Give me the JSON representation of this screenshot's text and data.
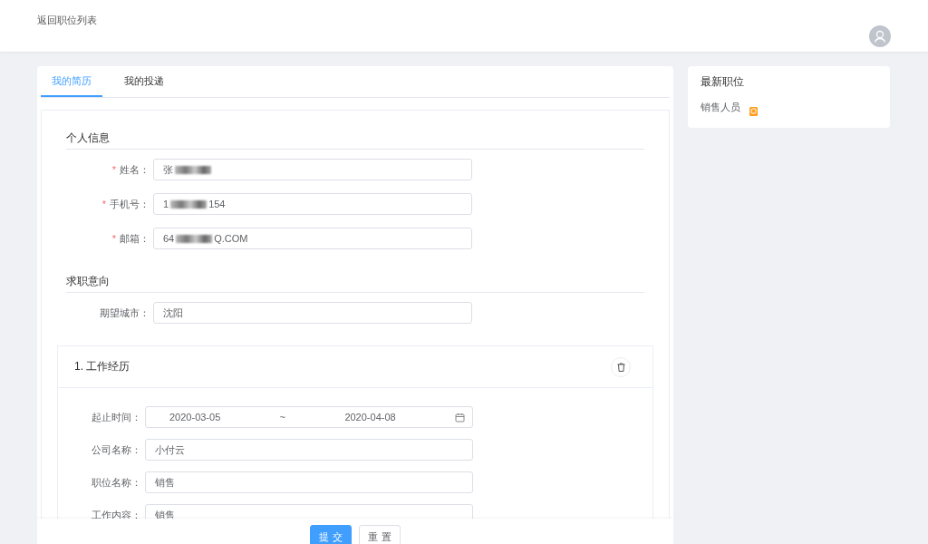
{
  "header": {
    "back_link": "返回职位列表"
  },
  "tabs": [
    {
      "label": "我的简历",
      "selected": true
    },
    {
      "label": "我的投递",
      "selected": false
    }
  ],
  "sections": [
    {
      "title": "个人信息",
      "fields": [
        {
          "required_mark": "*",
          "label": "姓名：",
          "value_start": "张",
          "redacted": true
        },
        {
          "required_mark": "*",
          "label": "手机号：",
          "value_start": "1",
          "redacted": true,
          "value_end": "154"
        },
        {
          "required_mark": "*",
          "label": "邮箱：",
          "value_start": "64",
          "redacted": true,
          "value_end": "Q.COM"
        }
      ]
    },
    {
      "title": "求职意向",
      "fields": [
        {
          "label": "期望城市：",
          "value_start": "沈阳"
        }
      ]
    }
  ],
  "experience": {
    "title": "1. 工作经历",
    "fields": [
      {
        "kind": "daterange",
        "label": "起止时间：",
        "start": "2020-03-05",
        "separator": "~",
        "end": "2020-04-08"
      },
      {
        "kind": "text",
        "label": "公司名称：",
        "value": "小付云"
      },
      {
        "kind": "text",
        "label": "职位名称：",
        "value": "销售"
      },
      {
        "kind": "text",
        "label": "工作内容：",
        "value": "销售"
      }
    ]
  },
  "actions": [
    {
      "label": "提 交",
      "primary": true
    },
    {
      "label": "重 置",
      "primary": false
    }
  ],
  "latest_jobs": {
    "title": "最新职位",
    "items": [
      {
        "label": "销售人员"
      }
    ]
  }
}
